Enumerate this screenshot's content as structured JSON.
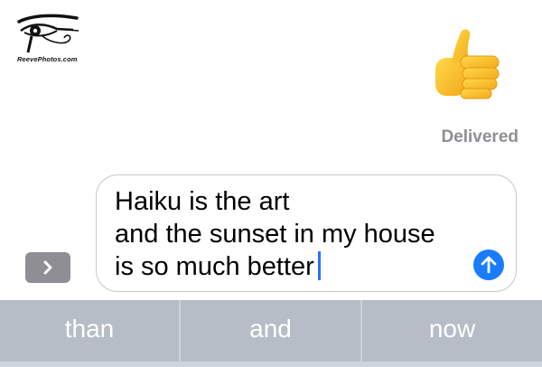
{
  "watermark": {
    "text": "ReevePhotos.com",
    "icon": "eye-of-horus-icon"
  },
  "message": {
    "reaction_icon": "thumbs-up-emoji",
    "status": "Delivered"
  },
  "composer": {
    "expand_icon": "chevron-right-icon",
    "lines": [
      "Haiku is the art",
      "and the sunset in my house",
      "is so much better"
    ],
    "send_icon": "arrow-up-icon",
    "send_color": "#1a7cfa",
    "cursor_color": "#2f6bff"
  },
  "predictive_bar": {
    "suggestions": [
      "than",
      "and",
      "now"
    ],
    "background": "#b7bdc6"
  }
}
